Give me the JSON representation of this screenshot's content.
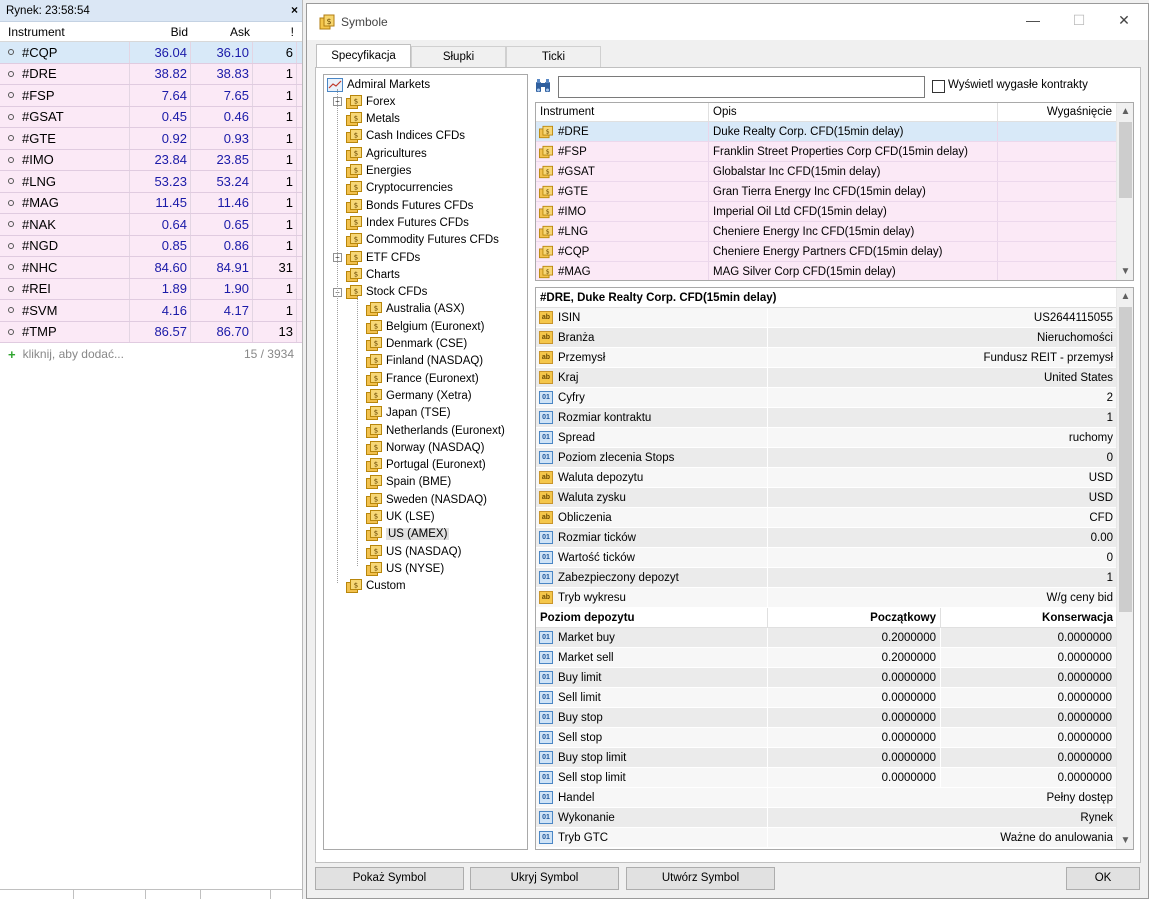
{
  "market_watch": {
    "title": "Rynek: 23:58:54",
    "close": "×",
    "columns": {
      "instrument": "Instrument",
      "bid": "Bid",
      "ask": "Ask",
      "extra": "!"
    },
    "rows": [
      {
        "symbol": "#CQP",
        "bid": "36.04",
        "ask": "36.10",
        "extra": "6"
      },
      {
        "symbol": "#DRE",
        "bid": "38.82",
        "ask": "38.83",
        "extra": "1"
      },
      {
        "symbol": "#FSP",
        "bid": "7.64",
        "ask": "7.65",
        "extra": "1"
      },
      {
        "symbol": "#GSAT",
        "bid": "0.45",
        "ask": "0.46",
        "extra": "1"
      },
      {
        "symbol": "#GTE",
        "bid": "0.92",
        "ask": "0.93",
        "extra": "1"
      },
      {
        "symbol": "#IMO",
        "bid": "23.84",
        "ask": "23.85",
        "extra": "1"
      },
      {
        "symbol": "#LNG",
        "bid": "53.23",
        "ask": "53.24",
        "extra": "1"
      },
      {
        "symbol": "#MAG",
        "bid": "11.45",
        "ask": "11.46",
        "extra": "1"
      },
      {
        "symbol": "#NAK",
        "bid": "0.64",
        "ask": "0.65",
        "extra": "1"
      },
      {
        "symbol": "#NGD",
        "bid": "0.85",
        "ask": "0.86",
        "extra": "1"
      },
      {
        "symbol": "#NHC",
        "bid": "84.60",
        "ask": "84.91",
        "extra": "31"
      },
      {
        "symbol": "#REI",
        "bid": "1.89",
        "ask": "1.90",
        "extra": "1"
      },
      {
        "symbol": "#SVM",
        "bid": "4.16",
        "ask": "4.17",
        "extra": "1"
      },
      {
        "symbol": "#TMP",
        "bid": "86.57",
        "ask": "86.70",
        "extra": "13"
      }
    ],
    "add_text": "kliknij, aby dodać...",
    "count": "15 / 3934"
  },
  "dialog": {
    "title": "Symbole",
    "window_buttons": {
      "minimize": "—",
      "maximize": "☐",
      "close": "✕"
    },
    "tabs": [
      "Specyfikacja",
      "Słupki",
      "Ticki"
    ],
    "show_expired_label": "Wyświetl wygasłe kontrakty",
    "tree": {
      "root": "Admiral Markets",
      "groups": [
        "Forex",
        "Metals",
        "Cash Indices CFDs",
        "Agricultures",
        "Energies",
        "Cryptocurrencies",
        "Bonds Futures CFDs",
        "Index Futures CFDs",
        "Commodity Futures CFDs",
        "ETF CFDs",
        "Charts",
        "Stock CFDs"
      ],
      "stock_children": [
        "Australia (ASX)",
        "Belgium (Euronext)",
        "Denmark (CSE)",
        "Finland (NASDAQ)",
        "France (Euronext)",
        "Germany (Xetra)",
        "Japan (TSE)",
        "Netherlands (Euronext)",
        "Norway (NASDAQ)",
        "Portugal (Euronext)",
        "Spain (BME)",
        "Sweden (NASDAQ)",
        "UK (LSE)",
        "US (AMEX)",
        "US (NASDAQ)",
        "US (NYSE)"
      ],
      "custom": "Custom"
    },
    "symbol_list": {
      "columns": {
        "instrument": "Instrument",
        "desc": "Opis",
        "exp": "Wygaśnięcie"
      },
      "rows": [
        {
          "symbol": "#DRE",
          "desc": "Duke Realty Corp. CFD(15min delay)"
        },
        {
          "symbol": "#FSP",
          "desc": "Franklin Street Properties Corp CFD(15min delay)"
        },
        {
          "symbol": "#GSAT",
          "desc": "Globalstar Inc CFD(15min delay)"
        },
        {
          "symbol": "#GTE",
          "desc": "Gran Tierra Energy Inc CFD(15min delay)"
        },
        {
          "symbol": "#IMO",
          "desc": "Imperial Oil Ltd CFD(15min delay)"
        },
        {
          "symbol": "#LNG",
          "desc": "Cheniere Energy Inc CFD(15min delay)"
        },
        {
          "symbol": "#CQP",
          "desc": "Cheniere Energy Partners CFD(15min delay)"
        },
        {
          "symbol": "#MAG",
          "desc": "MAG Silver Corp CFD(15min delay)"
        }
      ]
    },
    "properties": {
      "header": "#DRE, Duke Realty Corp. CFD(15min delay)",
      "rows": [
        {
          "icon": "ab",
          "label": "ISIN",
          "value": "US2644115055"
        },
        {
          "icon": "ab",
          "label": "Branża",
          "value": "Nieruchomości"
        },
        {
          "icon": "ab",
          "label": "Przemysł",
          "value": "Fundusz REIT - przemysł"
        },
        {
          "icon": "ab",
          "label": "Kraj",
          "value": "United States"
        },
        {
          "icon": "01",
          "label": "Cyfry",
          "value": "2"
        },
        {
          "icon": "01",
          "label": "Rozmiar kontraktu",
          "value": "1"
        },
        {
          "icon": "01",
          "label": "Spread",
          "value": "ruchomy"
        },
        {
          "icon": "01",
          "label": "Poziom zlecenia Stops",
          "value": "0"
        },
        {
          "icon": "ab",
          "label": "Waluta depozytu",
          "value": "USD"
        },
        {
          "icon": "ab",
          "label": "Waluta zysku",
          "value": "USD"
        },
        {
          "icon": "ab",
          "label": "Obliczenia",
          "value": "CFD"
        },
        {
          "icon": "01",
          "label": "Rozmiar ticków",
          "value": "0.00"
        },
        {
          "icon": "01",
          "label": "Wartość ticków",
          "value": "0"
        },
        {
          "icon": "01",
          "label": "Zabezpieczony depozyt",
          "value": "1"
        },
        {
          "icon": "ab",
          "label": "Tryb wykresu",
          "value": "W/g ceny bid"
        }
      ],
      "deposit_header": {
        "label": "Poziom depozytu",
        "initial": "Początkowy",
        "maintenance": "Konserwacja"
      },
      "deposit_rows": [
        {
          "label": "Market buy",
          "initial": "0.2000000",
          "maintenance": "0.0000000"
        },
        {
          "label": "Market sell",
          "initial": "0.2000000",
          "maintenance": "0.0000000"
        },
        {
          "label": "Buy limit",
          "initial": "0.0000000",
          "maintenance": "0.0000000"
        },
        {
          "label": "Sell limit",
          "initial": "0.0000000",
          "maintenance": "0.0000000"
        },
        {
          "label": "Buy stop",
          "initial": "0.0000000",
          "maintenance": "0.0000000"
        },
        {
          "label": "Sell stop",
          "initial": "0.0000000",
          "maintenance": "0.0000000"
        },
        {
          "label": "Buy stop limit",
          "initial": "0.0000000",
          "maintenance": "0.0000000"
        },
        {
          "label": "Sell stop limit",
          "initial": "0.0000000",
          "maintenance": "0.0000000"
        }
      ],
      "tail_rows": [
        {
          "icon": "01",
          "label": "Handel",
          "value": "Pełny dostęp"
        },
        {
          "icon": "01",
          "label": "Wykonanie",
          "value": "Rynek"
        },
        {
          "icon": "01",
          "label": "Tryb GTC",
          "value": "Ważne do anulowania"
        }
      ]
    },
    "buttons": {
      "show": "Pokaż Symbol",
      "hide": "Ukryj Symbol",
      "create": "Utwórz Symbol",
      "ok": "OK"
    }
  }
}
